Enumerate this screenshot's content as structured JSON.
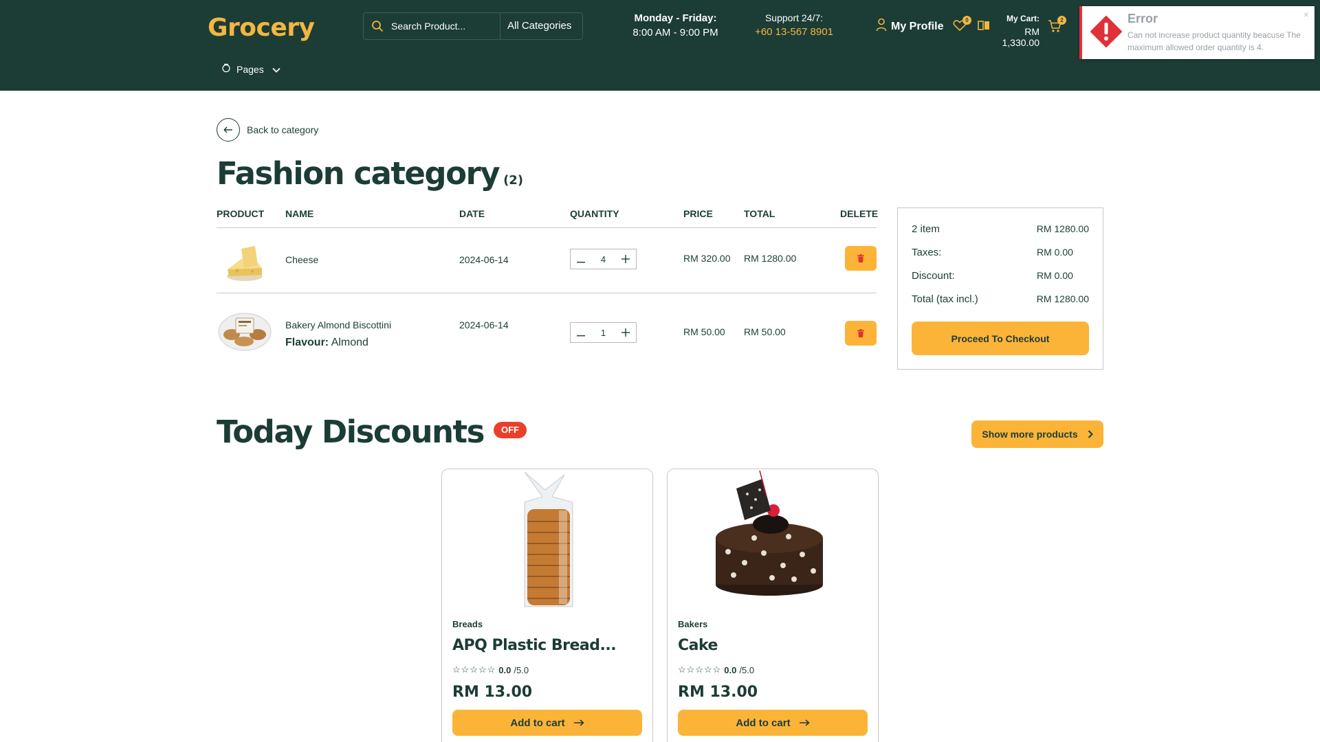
{
  "header": {
    "logo": "Grocery",
    "search_placeholder": "Search Product...",
    "categories": "All Categories",
    "hours_days": "Monday - Friday:",
    "hours_time": "8:00 AM - 9:00 PM",
    "support_label": "Support 24/7:",
    "support_phone": "+60 13-567 8901",
    "profile_label": "My Profile",
    "wishlist_count": "0",
    "cart_label": "My Cart:",
    "cart_total": "RM 1,330.00",
    "cart_count": "2",
    "pages_label": "Pages"
  },
  "toast": {
    "title": "Error",
    "message": "Can not increase product quantity beacuse The maximum allowed order quantity is 4.",
    "close": "×"
  },
  "main": {
    "back_label": "Back to category",
    "title": "Fashion category",
    "count": "(2)",
    "columns": {
      "product": "PRODUCT",
      "name": "NAME",
      "date": "DATE",
      "quantity": "QUANTITY",
      "price": "PRICE",
      "total": "TOTAL",
      "delete": "DELETE"
    },
    "items": [
      {
        "name": "Cheese",
        "date": "2024-06-14",
        "qty": "4",
        "price": "RM 320.00",
        "total": "RM 1280.00"
      },
      {
        "name": "Bakery Almond Biscottini",
        "flavour_label": "Flavour:",
        "flavour_value": "Almond",
        "date": "2024-06-14",
        "qty": "1",
        "price": "RM 50.00",
        "total": "RM 50.00"
      }
    ]
  },
  "summary": {
    "items_label": "2 item",
    "items_value": "RM 1280.00",
    "taxes_label": "Taxes:",
    "taxes_value": "RM 0.00",
    "discount_label": "Discount:",
    "discount_value": "RM 0.00",
    "total_label": "Total (tax incl.)",
    "total_value": "RM 1280.00",
    "checkout_label": "Proceed To Checkout"
  },
  "discounts": {
    "title": "Today Discounts",
    "badge": "OFF",
    "show_more": "Show more products",
    "products": [
      {
        "category": "Breads",
        "name": "APQ Plastic Bread...",
        "rating": "0.0",
        "rating_max": "/5.0",
        "price": "RM 13.00",
        "add_label": "Add to cart"
      },
      {
        "category": "Bakers",
        "name": "Cake",
        "rating": "0.0",
        "rating_max": "/5.0",
        "price": "RM 13.00",
        "add_label": "Add to cart"
      }
    ]
  },
  "colors": {
    "header_bg": "#1c3c36",
    "accent": "#fbb438",
    "brand": "#f3b63f",
    "error": "#e0303a",
    "off_badge": "#e8402c"
  },
  "icons": [
    "search-icon",
    "user-icon",
    "heart-icon",
    "compare-icon",
    "cart-icon",
    "pages-icon",
    "chevron-down-icon",
    "error-icon",
    "arrow-left-icon",
    "minus-icon",
    "plus-icon",
    "trash-icon",
    "chevron-right-icon",
    "arrow-right-icon",
    "star-icon"
  ]
}
